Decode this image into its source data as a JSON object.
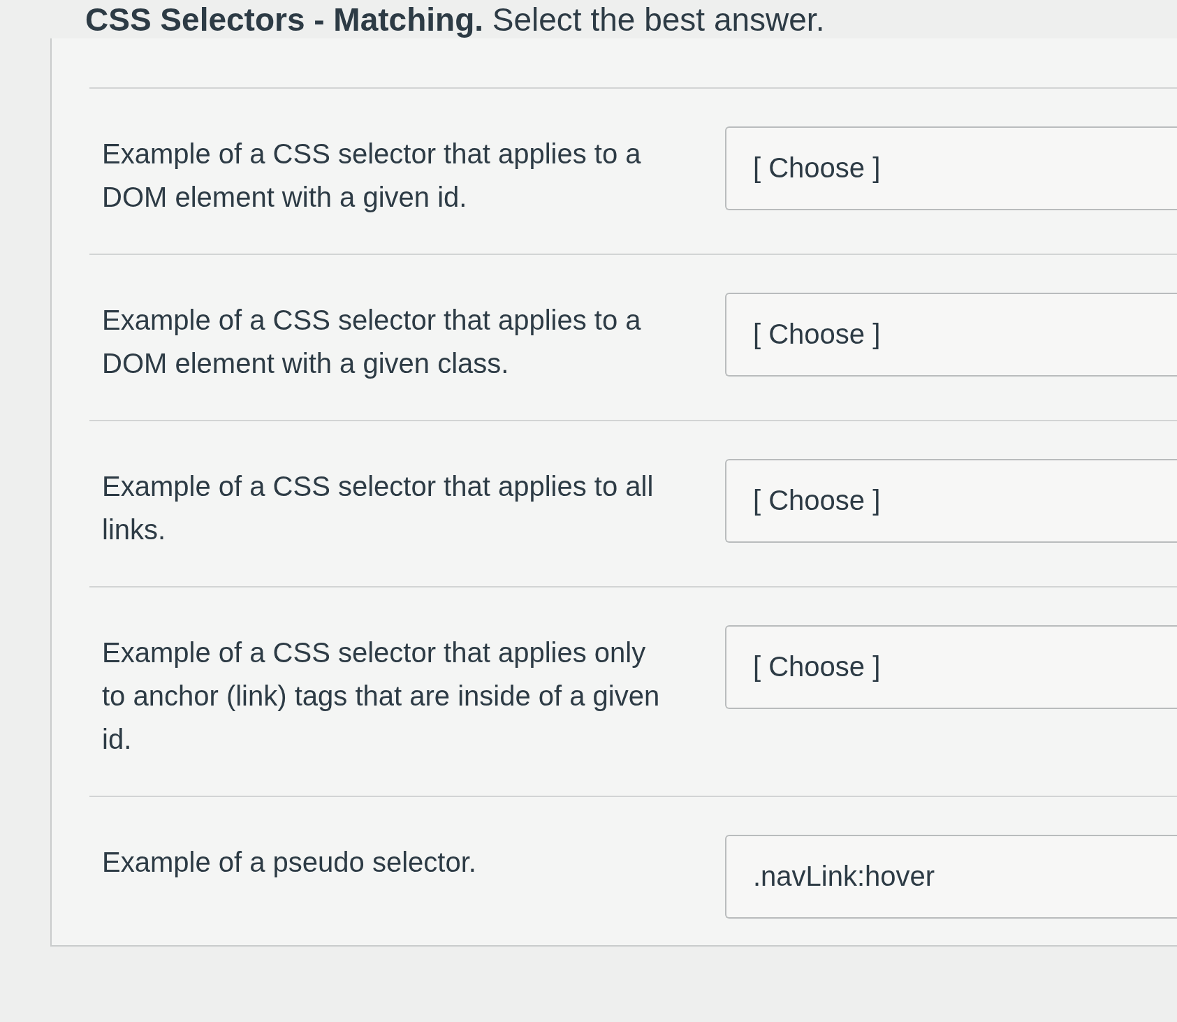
{
  "title": "**CSS Selectors - Matching.** Select the best answer.",
  "questions": [
    {
      "prompt": "Example of a CSS selector that applies to a DOM element with a given id.",
      "selection": "[ Choose ]"
    },
    {
      "prompt": "Example of a CSS selector that applies to a DOM element with a given class.",
      "selection": "[ Choose ]"
    },
    {
      "prompt": "Example of a CSS selector that applies to all links.",
      "selection": "[ Choose ]"
    },
    {
      "prompt": "Example of a CSS selector that applies only to anchor (link) tags that are inside of a given id.",
      "selection": "[ Choose ]"
    },
    {
      "prompt": "Example of a pseudo selector.",
      "selection": ".navLink:hover"
    }
  ]
}
